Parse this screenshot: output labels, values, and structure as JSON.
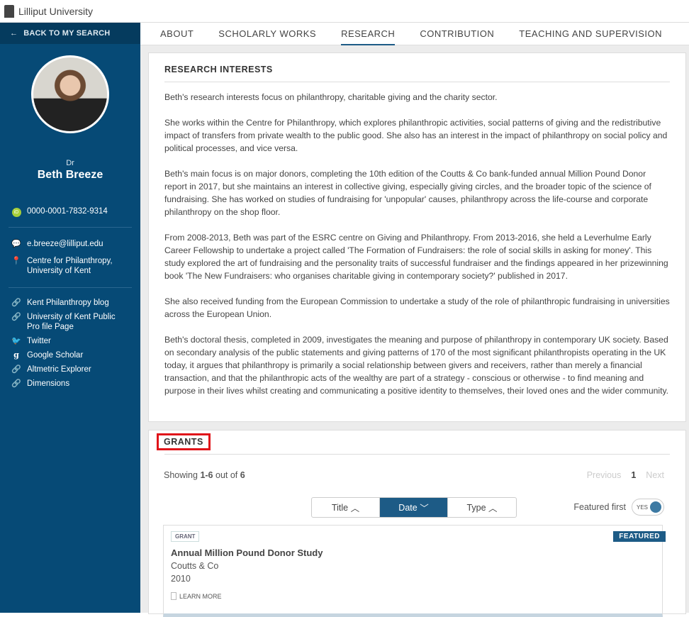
{
  "app": {
    "title": "Lilliput University"
  },
  "sidebar": {
    "back_label": "BACK TO MY SEARCH",
    "person_title": "Dr",
    "person_name": "Beth Breeze",
    "orcid": "0000-0001-7832-9314",
    "email": "e.breeze@lilliput.edu",
    "location": "Centre for Philanthropy, University of Kent",
    "links": [
      "Kent Philanthropy blog",
      "University of Kent Public Pro file Page",
      "Twitter",
      "Google Scholar",
      "Altmetric Explorer",
      "Dimensions"
    ]
  },
  "tabs": [
    "ABOUT",
    "SCHOLARLY WORKS",
    "RESEARCH",
    "CONTRIBUTION",
    "TEACHING AND SUPERVISION"
  ],
  "research": {
    "heading": "RESEARCH INTERESTS",
    "paragraphs": [
      "Beth's research interests focus on philanthropy, charitable giving and the charity sector.",
      "She works within the Centre for Philanthropy, which explores philanthropic activities, social patterns of giving and the redistributive impact of transfers from private wealth to the public good. She also has an interest in the impact of philanthropy on social policy and political processes, and vice versa.",
      "Beth's main focus is on major donors, completing the 10th edition of the Coutts & Co bank-funded annual Million Pound Donor report in 2017, but she maintains an interest in collective giving, especially giving circles, and the broader topic of the science of fundraising.  She has worked on studies of fundraising for 'unpopular' causes, philanthropy across the life-course and corporate philanthropy on the shop floor.",
      "From 2008-2013, Beth was part of the ESRC centre on Giving and Philanthropy. From 2013-2016, she held a Leverhulme Early Career Fellowship to undertake a project called 'The Formation of Fundraisers: the role of social skills in asking for money'. This study explored the art of fundraising and the personality traits of successful fundraiser and the findings appeared in her prizewinning book 'The New Fundraisers: who organises charitable giving in contemporary society?' published in 2017.",
      "She also received funding from the European Commission to undertake a study of the role of philanthropic fundraising in universities across the European Union.",
      "Beth's doctoral thesis, completed in 2009, investigates the meaning and purpose of philanthropy in contemporary UK society. Based on secondary analysis of the public statements and giving patterns of 170 of the most significant philanthropists operating in the UK today, it argues that philanthropy is primarily a social relationship between givers and receivers, rather than merely a financial transaction, and that the philanthropic acts of the wealthy are part of a strategy - conscious or otherwise - to find meaning and purpose in their lives whilst creating and communicating a positive identity to themselves, their loved ones and the wider community."
    ]
  },
  "grants": {
    "heading": "GRANTS",
    "showing_prefix": "Showing ",
    "showing_range": "1-6",
    "showing_mid": " out of ",
    "showing_total": "6",
    "prev": "Previous",
    "page": "1",
    "next": "Next",
    "sort": [
      {
        "label": "Title",
        "dir": "up"
      },
      {
        "label": "Date",
        "dir": "down"
      },
      {
        "label": "Type",
        "dir": "up"
      }
    ],
    "featured_label": "Featured first",
    "featured_toggle": "YES",
    "item": {
      "type": "GRANT",
      "badge": "FEATURED",
      "title": "Annual Million Pound Donor Study",
      "funder": "Coutts & Co",
      "year": "2010",
      "learn_more": "LEARN MORE"
    }
  },
  "colors": {
    "sidebar": "#064a76",
    "accent": "#1d5b86",
    "highlight": "#e0141a",
    "orcid": "#a6ce39"
  }
}
